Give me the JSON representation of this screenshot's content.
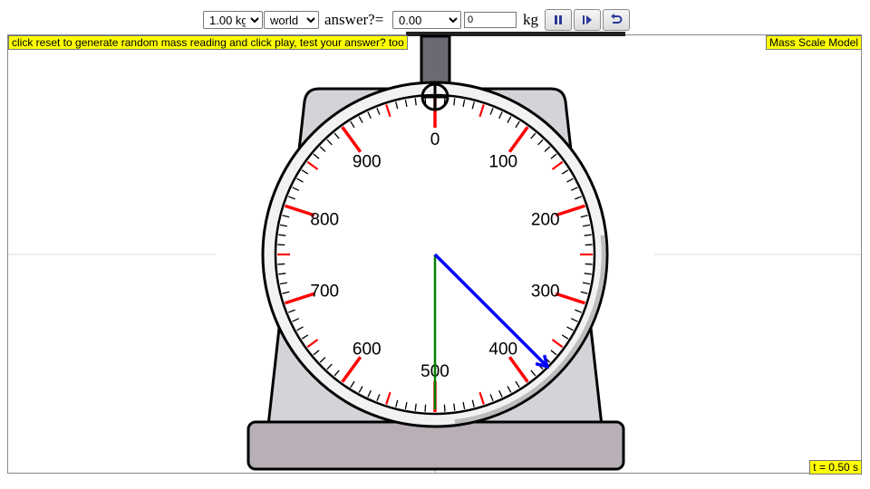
{
  "toolbar": {
    "mass_option": "1.00 kg",
    "world_option": "world",
    "answer_label": "answer?=",
    "answer_option": "0.00",
    "answer_input_value": "0",
    "unit_label": "kg"
  },
  "badges": {
    "instruction": "click reset to generate random mass reading and click play, test your answer? too",
    "title": "Mass Scale Model",
    "time": "t = 0.50 s"
  },
  "dial": {
    "labels": [
      "0",
      "100",
      "200",
      "300",
      "400",
      "500",
      "600",
      "700",
      "800",
      "900"
    ],
    "max_value": 1000,
    "pointer_value": 375,
    "reference_value": 500
  },
  "colors": {
    "major_tick": "#ff0000",
    "minor_tick": "#000000",
    "pointer": "#0000ff",
    "reference_line": "#008000",
    "scale_body": "#d5d3d8",
    "base": "#b8b0b6",
    "badge": "#ffff00"
  },
  "icons": {
    "pause": "pause-icon",
    "step": "step-forward-icon",
    "reset": "reset-icon"
  }
}
